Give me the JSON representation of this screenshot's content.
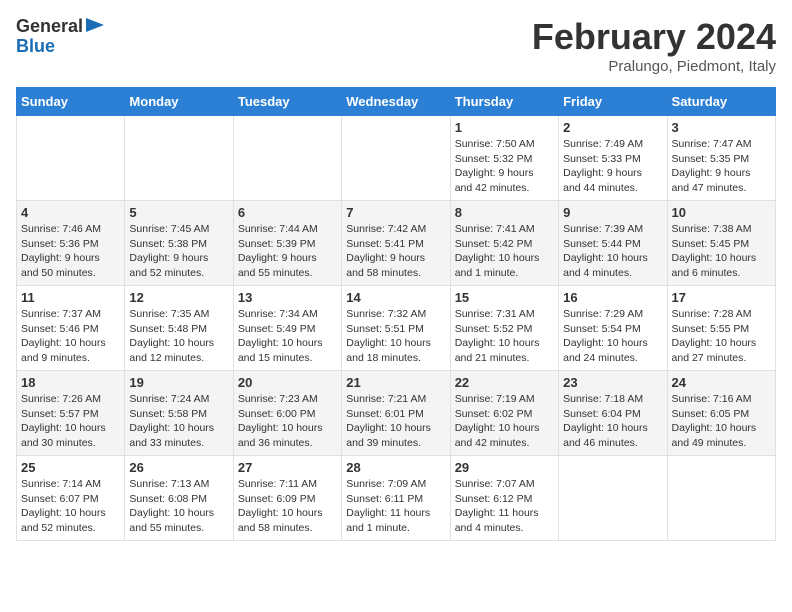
{
  "header": {
    "logo_line1": "General",
    "logo_line2": "Blue",
    "month_title": "February 2024",
    "subtitle": "Pralungo, Piedmont, Italy"
  },
  "days_of_week": [
    "Sunday",
    "Monday",
    "Tuesday",
    "Wednesday",
    "Thursday",
    "Friday",
    "Saturday"
  ],
  "weeks": [
    [
      {
        "day": "",
        "content": ""
      },
      {
        "day": "",
        "content": ""
      },
      {
        "day": "",
        "content": ""
      },
      {
        "day": "",
        "content": ""
      },
      {
        "day": "1",
        "content": "Sunrise: 7:50 AM\nSunset: 5:32 PM\nDaylight: 9 hours\nand 42 minutes."
      },
      {
        "day": "2",
        "content": "Sunrise: 7:49 AM\nSunset: 5:33 PM\nDaylight: 9 hours\nand 44 minutes."
      },
      {
        "day": "3",
        "content": "Sunrise: 7:47 AM\nSunset: 5:35 PM\nDaylight: 9 hours\nand 47 minutes."
      }
    ],
    [
      {
        "day": "4",
        "content": "Sunrise: 7:46 AM\nSunset: 5:36 PM\nDaylight: 9 hours\nand 50 minutes."
      },
      {
        "day": "5",
        "content": "Sunrise: 7:45 AM\nSunset: 5:38 PM\nDaylight: 9 hours\nand 52 minutes."
      },
      {
        "day": "6",
        "content": "Sunrise: 7:44 AM\nSunset: 5:39 PM\nDaylight: 9 hours\nand 55 minutes."
      },
      {
        "day": "7",
        "content": "Sunrise: 7:42 AM\nSunset: 5:41 PM\nDaylight: 9 hours\nand 58 minutes."
      },
      {
        "day": "8",
        "content": "Sunrise: 7:41 AM\nSunset: 5:42 PM\nDaylight: 10 hours\nand 1 minute."
      },
      {
        "day": "9",
        "content": "Sunrise: 7:39 AM\nSunset: 5:44 PM\nDaylight: 10 hours\nand 4 minutes."
      },
      {
        "day": "10",
        "content": "Sunrise: 7:38 AM\nSunset: 5:45 PM\nDaylight: 10 hours\nand 6 minutes."
      }
    ],
    [
      {
        "day": "11",
        "content": "Sunrise: 7:37 AM\nSunset: 5:46 PM\nDaylight: 10 hours\nand 9 minutes."
      },
      {
        "day": "12",
        "content": "Sunrise: 7:35 AM\nSunset: 5:48 PM\nDaylight: 10 hours\nand 12 minutes."
      },
      {
        "day": "13",
        "content": "Sunrise: 7:34 AM\nSunset: 5:49 PM\nDaylight: 10 hours\nand 15 minutes."
      },
      {
        "day": "14",
        "content": "Sunrise: 7:32 AM\nSunset: 5:51 PM\nDaylight: 10 hours\nand 18 minutes."
      },
      {
        "day": "15",
        "content": "Sunrise: 7:31 AM\nSunset: 5:52 PM\nDaylight: 10 hours\nand 21 minutes."
      },
      {
        "day": "16",
        "content": "Sunrise: 7:29 AM\nSunset: 5:54 PM\nDaylight: 10 hours\nand 24 minutes."
      },
      {
        "day": "17",
        "content": "Sunrise: 7:28 AM\nSunset: 5:55 PM\nDaylight: 10 hours\nand 27 minutes."
      }
    ],
    [
      {
        "day": "18",
        "content": "Sunrise: 7:26 AM\nSunset: 5:57 PM\nDaylight: 10 hours\nand 30 minutes."
      },
      {
        "day": "19",
        "content": "Sunrise: 7:24 AM\nSunset: 5:58 PM\nDaylight: 10 hours\nand 33 minutes."
      },
      {
        "day": "20",
        "content": "Sunrise: 7:23 AM\nSunset: 6:00 PM\nDaylight: 10 hours\nand 36 minutes."
      },
      {
        "day": "21",
        "content": "Sunrise: 7:21 AM\nSunset: 6:01 PM\nDaylight: 10 hours\nand 39 minutes."
      },
      {
        "day": "22",
        "content": "Sunrise: 7:19 AM\nSunset: 6:02 PM\nDaylight: 10 hours\nand 42 minutes."
      },
      {
        "day": "23",
        "content": "Sunrise: 7:18 AM\nSunset: 6:04 PM\nDaylight: 10 hours\nand 46 minutes."
      },
      {
        "day": "24",
        "content": "Sunrise: 7:16 AM\nSunset: 6:05 PM\nDaylight: 10 hours\nand 49 minutes."
      }
    ],
    [
      {
        "day": "25",
        "content": "Sunrise: 7:14 AM\nSunset: 6:07 PM\nDaylight: 10 hours\nand 52 minutes."
      },
      {
        "day": "26",
        "content": "Sunrise: 7:13 AM\nSunset: 6:08 PM\nDaylight: 10 hours\nand 55 minutes."
      },
      {
        "day": "27",
        "content": "Sunrise: 7:11 AM\nSunset: 6:09 PM\nDaylight: 10 hours\nand 58 minutes."
      },
      {
        "day": "28",
        "content": "Sunrise: 7:09 AM\nSunset: 6:11 PM\nDaylight: 11 hours\nand 1 minute."
      },
      {
        "day": "29",
        "content": "Sunrise: 7:07 AM\nSunset: 6:12 PM\nDaylight: 11 hours\nand 4 minutes."
      },
      {
        "day": "",
        "content": ""
      },
      {
        "day": "",
        "content": ""
      }
    ]
  ]
}
